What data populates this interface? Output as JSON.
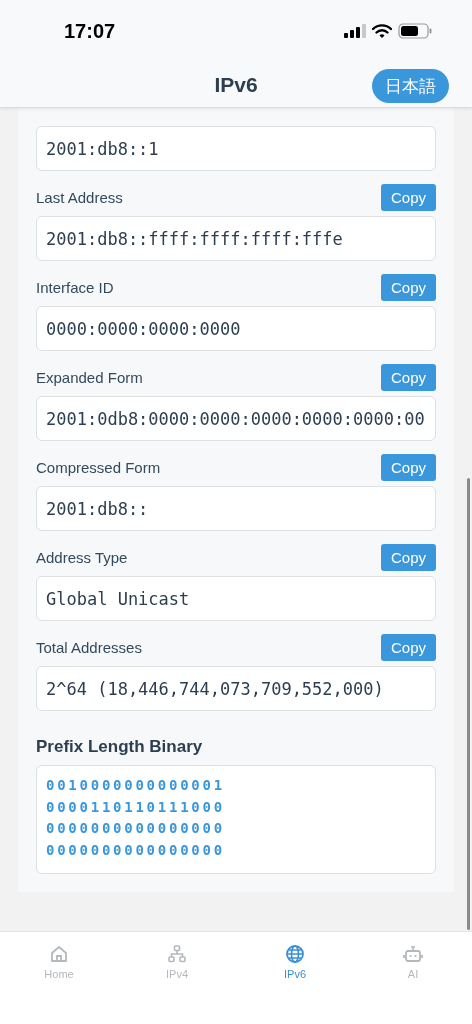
{
  "status_bar": {
    "time": "17:07"
  },
  "header": {
    "title": "IPv6",
    "language_button": "日本語"
  },
  "fields": [
    {
      "value": "2001:db8::1"
    },
    {
      "label": "Last Address",
      "button": "Copy",
      "value": "2001:db8::ffff:ffff:ffff:fffe"
    },
    {
      "label": "Interface ID",
      "button": "Copy",
      "value": "0000:0000:0000:0000"
    },
    {
      "label": "Expanded Form",
      "button": "Copy",
      "value": "2001:0db8:0000:0000:0000:0000:0000:00"
    },
    {
      "label": "Compressed Form",
      "button": "Copy",
      "value": "2001:db8::"
    },
    {
      "label": "Address Type",
      "button": "Copy",
      "value": "Global Unicast"
    },
    {
      "label": "Total Addresses",
      "button": "Copy",
      "value": "2^64 (18,446,744,073,709,552,000)"
    }
  ],
  "binary": {
    "title": "Prefix Length Binary",
    "lines": [
      "0010000000000001",
      "0000110110111000",
      "0000000000000000",
      "0000000000000000"
    ]
  },
  "tabs": [
    {
      "label": "Home",
      "selected": false
    },
    {
      "label": "IPv4",
      "selected": false
    },
    {
      "label": "IPv6",
      "selected": true
    },
    {
      "label": "AI",
      "selected": false
    }
  ]
}
